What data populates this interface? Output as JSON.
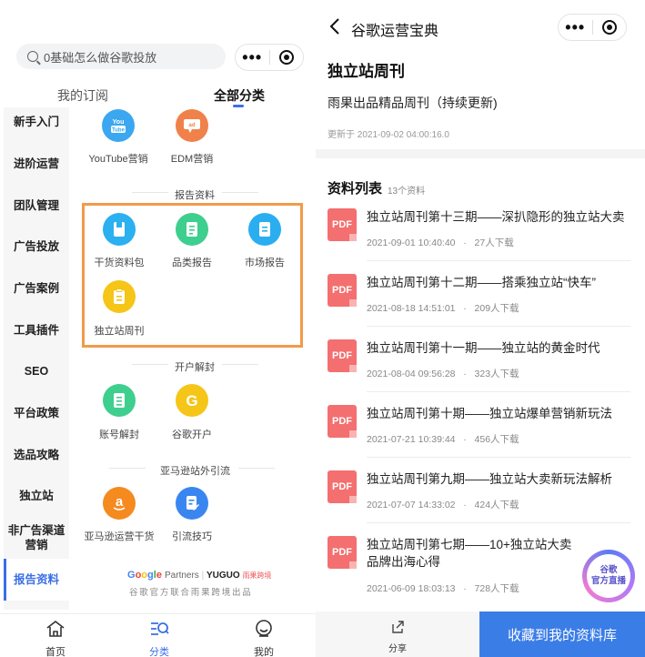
{
  "left": {
    "search": {
      "placeholder": "0基础怎么做谷歌投放"
    },
    "tabs": {
      "subscribed": "我的订阅",
      "all": "全部分类"
    },
    "sidebar": {
      "items": [
        "新手入门",
        "进阶运营",
        "团队管理",
        "广告投放",
        "广告案例",
        "工具插件",
        "SEO",
        "平台政策",
        "选品攻略",
        "独立站",
        "非广告渠道营销",
        "报告资料"
      ],
      "active": "报告资料"
    },
    "top_items": [
      {
        "label": "YouTube营销",
        "icon": "youtube-icon",
        "color": "#3ba7f0"
      },
      {
        "label": "EDM营销",
        "icon": "email-ad-icon",
        "color": "#f0814a"
      }
    ],
    "sections": {
      "report": {
        "title": "报告资料",
        "items": [
          {
            "label": "干货资料包",
            "icon": "pack-icon",
            "color": "#2bb0f0"
          },
          {
            "label": "品类报告",
            "icon": "report-icon",
            "color": "#3ecf8e"
          },
          {
            "label": "市场报告",
            "icon": "market-icon",
            "color": "#2aaef0"
          },
          {
            "label": "独立站周刊",
            "icon": "weekly-icon",
            "color": "#f5c518"
          }
        ]
      },
      "unban": {
        "title": "开户解封",
        "items": [
          {
            "label": "账号解封",
            "icon": "unlock-doc-icon",
            "color": "#3ecf8e"
          },
          {
            "label": "谷歌开户",
            "icon": "google-g-icon",
            "color": "#f5c518"
          }
        ]
      },
      "amazon": {
        "title": "亚马逊站外引流",
        "items": [
          {
            "label": "亚马逊运营干货",
            "icon": "amazon-icon",
            "color": "#f58a1f"
          },
          {
            "label": "引流技巧",
            "icon": "traffic-doc-icon",
            "color": "#3a86f0"
          }
        ]
      }
    },
    "partners": {
      "google": "Google Partners",
      "yuguo": "YUGUO",
      "yuguo_cn": "雨果跨境",
      "sub": "谷歌官方联合雨果跨境出品"
    },
    "bottom_nav": [
      "首页",
      "分类",
      "我的"
    ]
  },
  "right": {
    "title": "谷歌运营宝典",
    "heading": "独立站周刊",
    "subtitle": "雨果出品精品周刊（持续更新)",
    "updated": "更新于 2021-09-02 04:00:16.0",
    "list_title": "资料列表",
    "list_count": "13个资料",
    "file_tag": "PDF",
    "items": [
      {
        "title": "独立站周刊第十三期——深扒隐形的独立站大卖",
        "date": "2021-09-01 10:40:40",
        "downloads": "27人下载"
      },
      {
        "title": "独立站周刊第十二期——搭乘独立站“快车”",
        "date": "2021-08-18 14:51:01",
        "downloads": "209人下载"
      },
      {
        "title": "独立站周刊第十一期——独立站的黄金时代",
        "date": "2021-08-04 09:56:28",
        "downloads": "323人下载"
      },
      {
        "title": "独立站周刊第十期——独立站爆单营销新玩法",
        "date": "2021-07-21 10:39:44",
        "downloads": "456人下载"
      },
      {
        "title": "独立站周刊第九期——独立站大卖新玩法解析",
        "date": "2021-07-07 14:33:02",
        "downloads": "424人下载"
      },
      {
        "title": "独立站周刊第七期——10+独立站大卖品牌出海心得",
        "date": "2021-06-09 18:03:13",
        "downloads": "728人下载"
      }
    ],
    "dot": "·",
    "float": {
      "line1": "谷歌",
      "line2": "官方直播"
    },
    "share": "分享",
    "collect": "收藏到我的资料库"
  },
  "colors": {
    "accent": "#3a6fe6",
    "highlight_box": "#f29a4a",
    "pdf": "#f46f6f",
    "collect_button": "#3b7de6"
  }
}
